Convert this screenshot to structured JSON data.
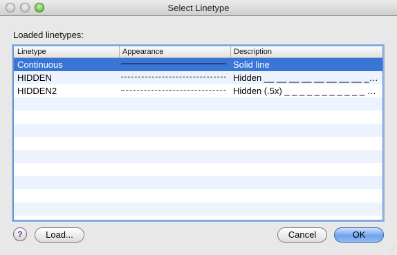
{
  "window": {
    "title": "Select Linetype"
  },
  "section_label": "Loaded linetypes:",
  "table": {
    "columns": [
      "Linetype",
      "Appearance",
      "Description"
    ],
    "rows": [
      {
        "name": "Continuous",
        "appearance": "solid",
        "description": "Solid line",
        "selected": true
      },
      {
        "name": "HIDDEN",
        "appearance": "dashed",
        "description": "Hidden __ __ __ __ __ __ __ __ __ __ __",
        "selected": false
      },
      {
        "name": "HIDDEN2",
        "appearance": "dotted",
        "description": "Hidden (.5x) _ _ _ _ _ _ _ _ _ _ _ _ _ _ _ _",
        "selected": false
      }
    ]
  },
  "buttons": {
    "help": "?",
    "load": "Load...",
    "cancel": "Cancel",
    "ok": "OK"
  },
  "colors": {
    "selection": "#3875d7",
    "stripe": "#edf3fe",
    "focus_ring": "#8fb2ea"
  }
}
